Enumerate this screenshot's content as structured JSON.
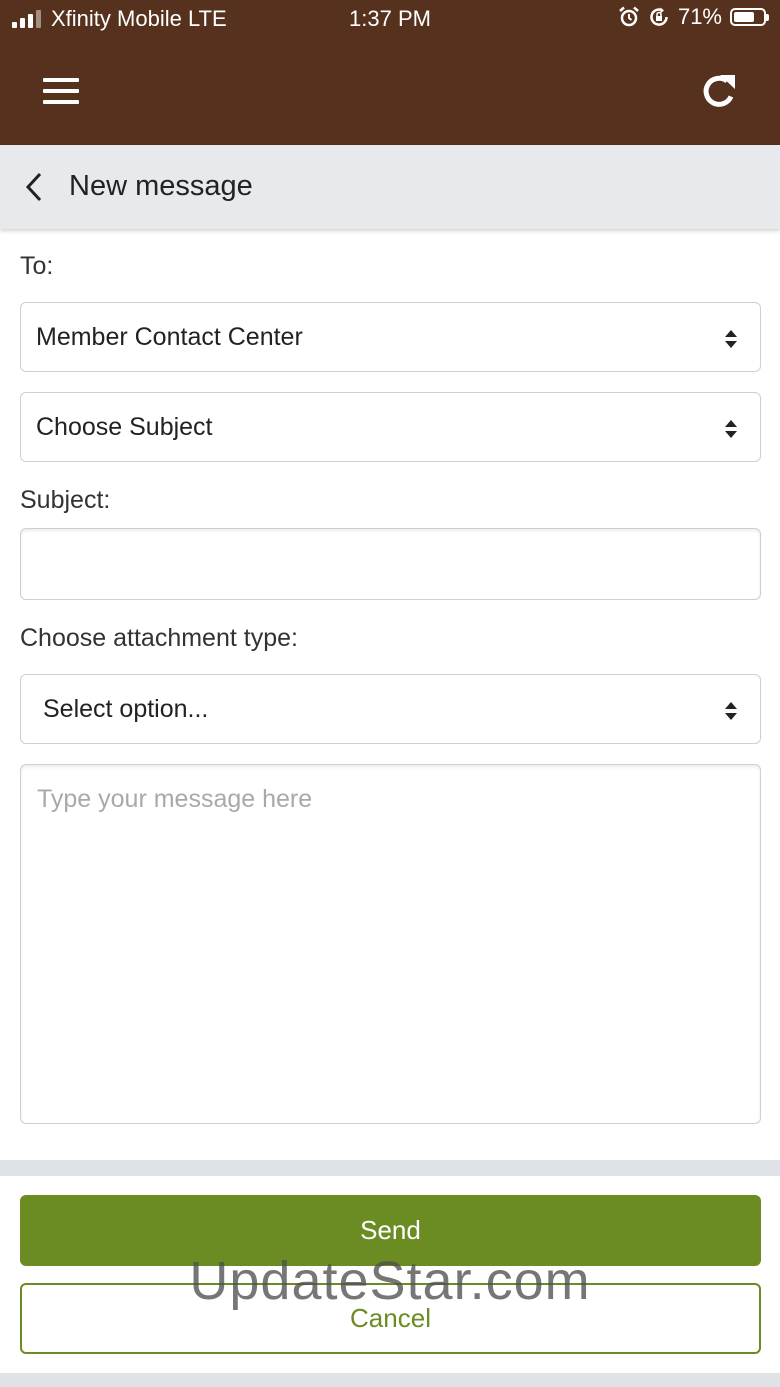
{
  "status_bar": {
    "carrier": "Xfinity Mobile LTE",
    "time": "1:37 PM",
    "battery": "71%",
    "battery_level": 0.71,
    "icons": [
      "signal-icon",
      "alarm-icon",
      "rotation-lock-icon",
      "battery-icon"
    ]
  },
  "toolbar": {
    "menu_icon": "hamburger-menu-icon",
    "refresh_icon": "refresh-icon"
  },
  "header": {
    "back_icon": "chevron-left-icon",
    "title": "New message"
  },
  "form": {
    "to_label": "To:",
    "recipient_selected": "Member Contact Center",
    "subject_choice_selected": "Choose Subject",
    "subject_label": "Subject:",
    "subject_value": "",
    "attachment_label": "Choose attachment type:",
    "attachment_selected": "Select option...",
    "message_placeholder": "Type your message here",
    "message_value": ""
  },
  "actions": {
    "send_label": "Send",
    "cancel_label": "Cancel"
  },
  "watermark": "UpdateStar.com",
  "colors": {
    "topbar": "#56321e",
    "header": "#e7e9ec",
    "accent": "#6b8b23"
  }
}
